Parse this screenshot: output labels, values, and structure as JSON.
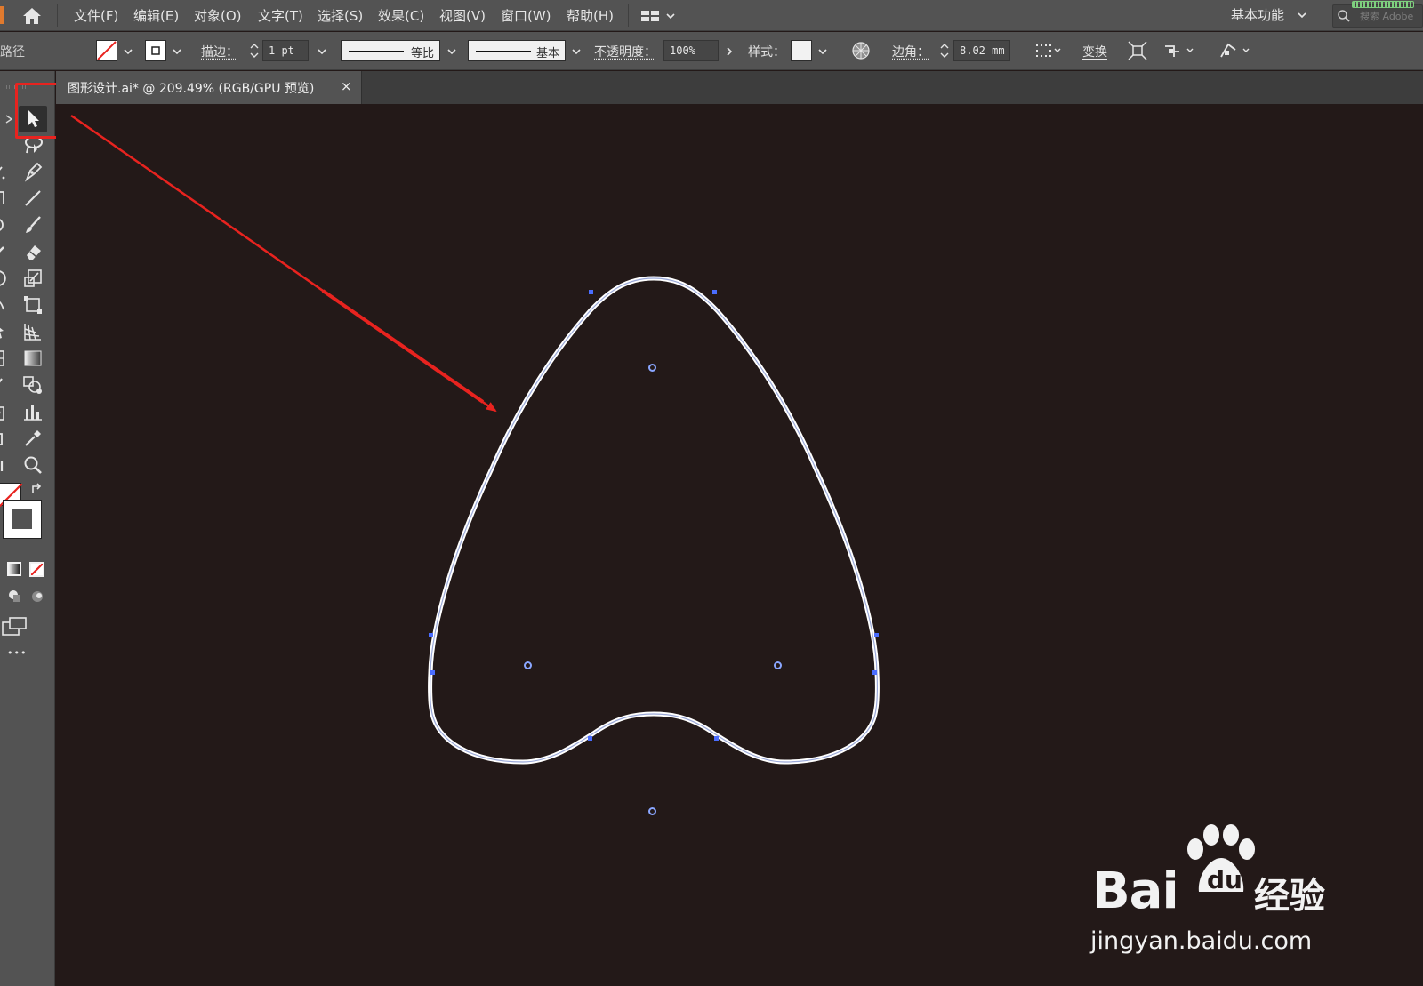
{
  "menubar": {
    "items": [
      "文件(F)",
      "编辑(E)",
      "对象(O)",
      "文字(T)",
      "选择(S)",
      "效果(C)",
      "视图(V)",
      "窗口(W)",
      "帮助(H)"
    ],
    "workspace": "基本功能",
    "search_placeholder": "搜索 Adobe"
  },
  "controlbar": {
    "title": "路径",
    "stroke_label": "描边：",
    "stroke_weight": "1 pt",
    "profile_label": "等比",
    "brush_label": "基本",
    "opacity_label": "不透明度：",
    "opacity_value": "100%",
    "style_label": "样式：",
    "corner_label": "边角：",
    "corner_value": "8.02 mm",
    "transform_label": "变换"
  },
  "document": {
    "tab_title": "图形设计.ai* @ 209.49% (RGB/GPU 预览)",
    "close_glyph": "×"
  },
  "toolbar": {
    "tools": [
      "selection-tool",
      "lasso-tool",
      "pen-tool",
      "line-tool",
      "brush-tool",
      "eraser-tool",
      "scale-tool",
      "free-transform-tool",
      "perspective-grid-tool",
      "gradient-tool",
      "shape-builder-tool",
      "column-graph-tool",
      "eyedropper-tool",
      "zoom-tool"
    ],
    "more_glyph": "•••",
    "highlighted_tool": "selection-tool"
  },
  "annotation": {
    "highlight_color": "#e8231f",
    "arrow_color": "#e8231f"
  },
  "colors": {
    "canvas": "#231918",
    "ui_panel": "#535353",
    "anchor": "#4a6dff",
    "path_stroke": "#ffffff"
  },
  "watermark": {
    "brand": "Bai",
    "brand_du": "du",
    "product": "经验",
    "url": "jingyan.baidu.com"
  }
}
